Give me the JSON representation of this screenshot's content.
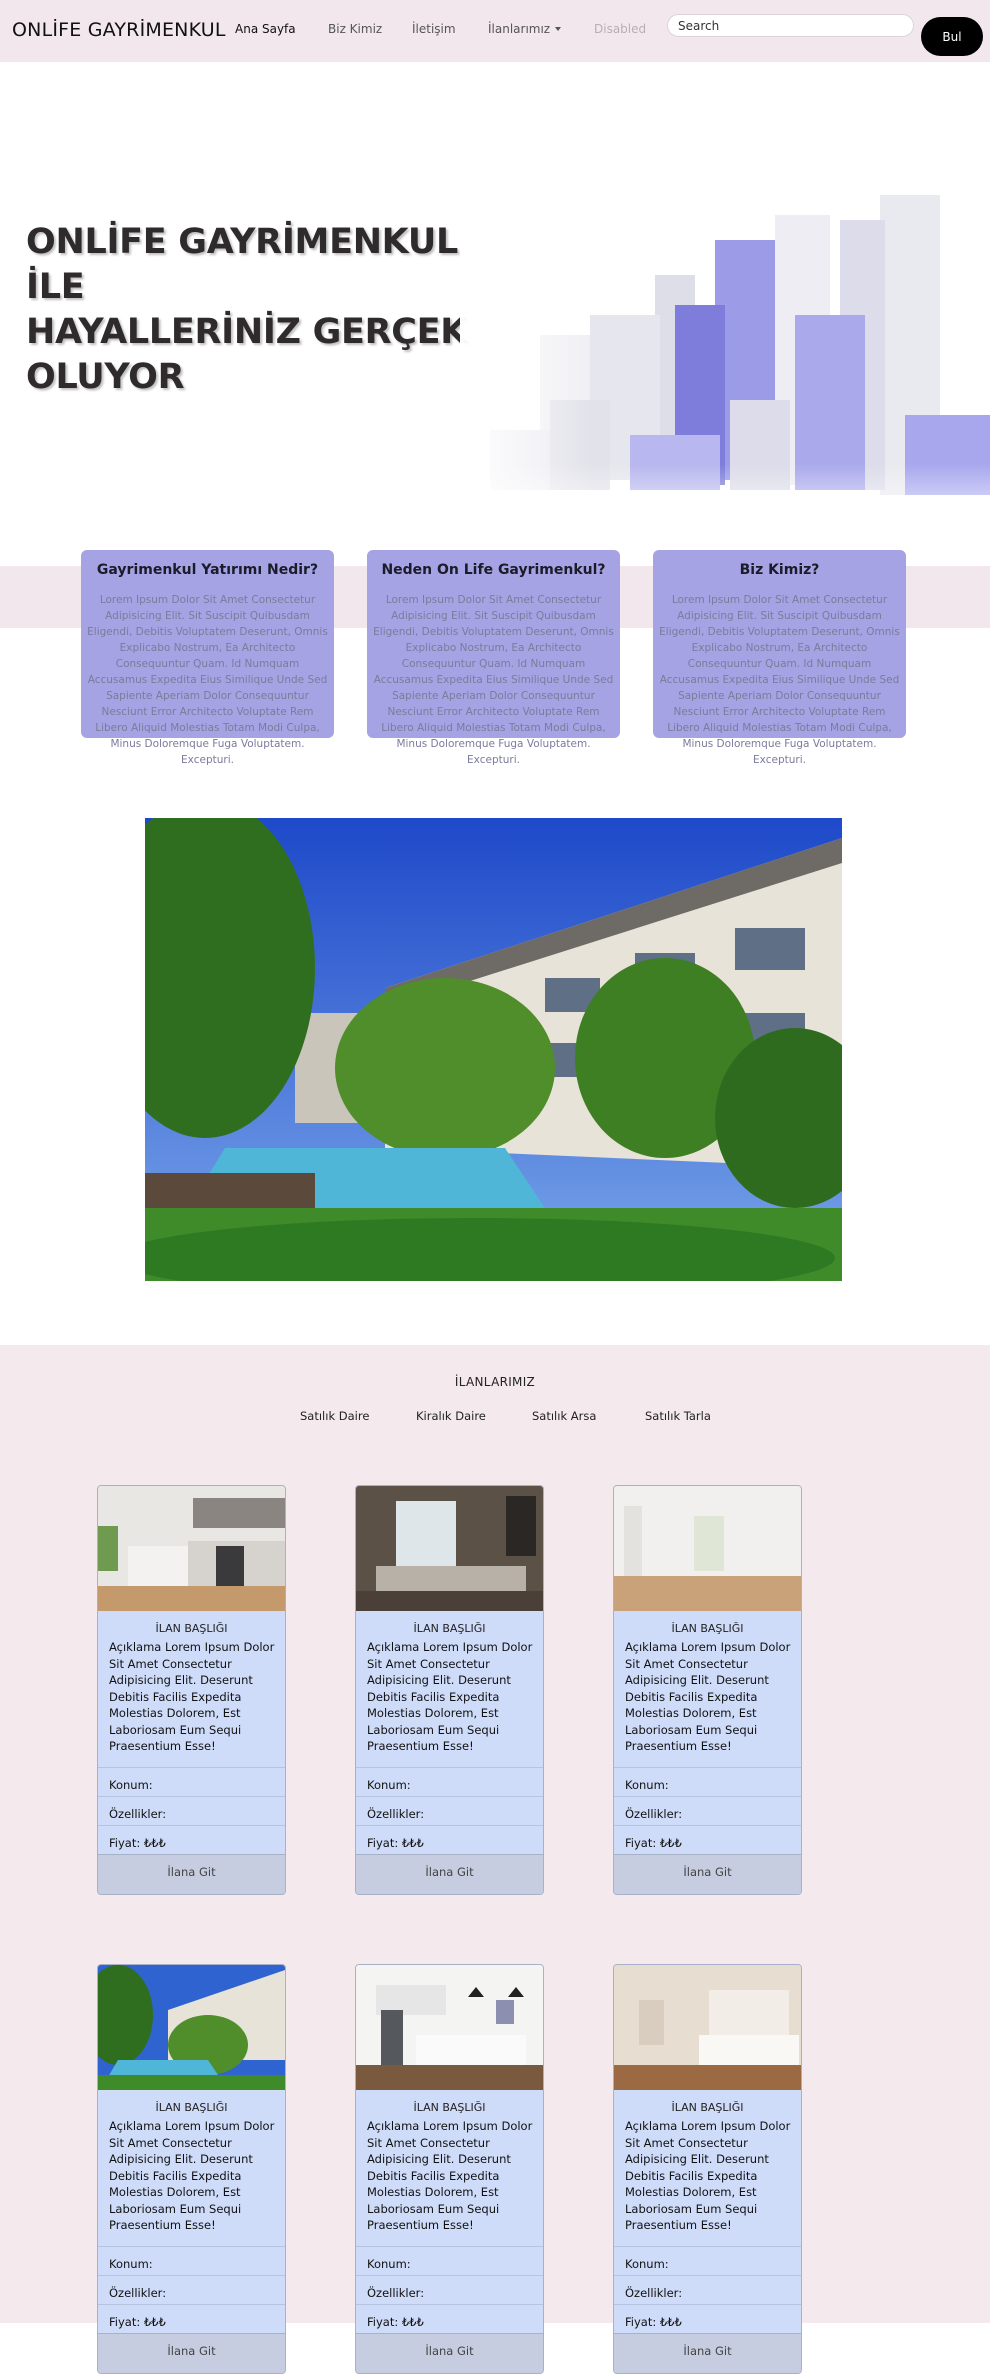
{
  "navbar": {
    "brand": "ONLİFE GAYRİMENKUL",
    "links": [
      "Ana Sayfa",
      "Biz Kimiz",
      "İletişim",
      "İlanlarımız",
      "Disabled"
    ],
    "search_placeholder": "Search",
    "search_button": "Bul"
  },
  "hero": {
    "lines": [
      "ONLİFE GAYRİMENKUL",
      "İLE",
      "HAYALLERİNİZ GERÇEK",
      "OLUYOR"
    ]
  },
  "info_cards": [
    {
      "title": "Gayrimenkul Yatırımı Nedir?",
      "text": "Lorem Ipsum Dolor Sit Amet Consectetur Adipisicing Elit. Sit Suscipit Quibusdam Eligendi, Debitis Voluptatem Deserunt, Omnis Explicabo Nostrum, Ea Architecto Consequuntur Quam. Id Numquam Accusamus Expedita Eius Similique Unde Sed Sapiente Aperiam Dolor Consequuntur Nesciunt Error Architecto Voluptate Rem Libero Aliquid Molestias Totam Modi Culpa, Minus Doloremque Fuga Voluptatem. Excepturi."
    },
    {
      "title": "Neden On Life Gayrimenkul?",
      "text": "Lorem Ipsum Dolor Sit Amet Consectetur Adipisicing Elit. Sit Suscipit Quibusdam Eligendi, Debitis Voluptatem Deserunt, Omnis Explicabo Nostrum, Ea Architecto Consequuntur Quam. Id Numquam Accusamus Expedita Eius Similique Unde Sed Sapiente Aperiam Dolor Consequuntur Nesciunt Error Architecto Voluptate Rem Libero Aliquid Molestias Totam Modi Culpa, Minus Doloremque Fuga Voluptatem. Excepturi."
    },
    {
      "title": "Biz Kimiz?",
      "text": "Lorem Ipsum Dolor Sit Amet Consectetur Adipisicing Elit. Sit Suscipit Quibusdam Eligendi, Debitis Voluptatem Deserunt, Omnis Explicabo Nostrum, Ea Architecto Consequuntur Quam. Id Numquam Accusamus Expedita Eius Similique Unde Sed Sapiente Aperiam Dolor Consequuntur Nesciunt Error Architecto Voluptate Rem Libero Aliquid Molestias Totam Modi Culpa, Minus Doloremque Fuga Voluptatem. Excepturi."
    }
  ],
  "listings": {
    "title": "İLANLARIMIZ",
    "categories": [
      "Satılık Daire",
      "Kiralık Daire",
      "Satılık Arsa",
      "Satılık Tarla"
    ],
    "cards": [
      {
        "image": "kitchen-photo",
        "heading": "İLAN BAŞLIĞI",
        "description": "Açıklama Lorem Ipsum Dolor Sit Amet Consectetur Adipisicing Elit. Deserunt Debitis Facilis Expedita Molestias Dolorem, Est Laboriosam Eum Sequi Praesentium Esse!",
        "location": "Konum:",
        "features": "Özellikler:",
        "price": "Fiyat: ₺₺₺",
        "button": "İlana Git"
      },
      {
        "image": "living-room-photo",
        "heading": "İLAN BAŞLIĞI",
        "description": "Açıklama Lorem Ipsum Dolor Sit Amet Consectetur Adipisicing Elit. Deserunt Debitis Facilis Expedita Molestias Dolorem, Est Laboriosam Eum Sequi Praesentium Esse!",
        "location": "Konum:",
        "features": "Özellikler:",
        "price": "Fiyat: ₺₺₺",
        "button": "İlana Git"
      },
      {
        "image": "empty-room-photo",
        "heading": "İLAN BAŞLIĞI",
        "description": "Açıklama Lorem Ipsum Dolor Sit Amet Consectetur Adipisicing Elit. Deserunt Debitis Facilis Expedita Molestias Dolorem, Est Laboriosam Eum Sequi Praesentium Esse!",
        "location": "Konum:",
        "features": "Özellikler:",
        "price": "Fiyat: ₺₺₺",
        "button": "İlana Git"
      },
      {
        "image": "pool-building-photo",
        "heading": "İLAN BAŞLIĞI",
        "description": "Açıklama Lorem Ipsum Dolor Sit Amet Consectetur Adipisicing Elit. Deserunt Debitis Facilis Expedita Molestias Dolorem, Est Laboriosam Eum Sequi Praesentium Esse!",
        "location": "Konum:",
        "features": "Özellikler:",
        "price": "Fiyat: ₺₺₺",
        "button": "İlana Git"
      },
      {
        "image": "modern-kitchen-photo",
        "heading": "İLAN BAŞLIĞI",
        "description": "Açıklama Lorem Ipsum Dolor Sit Amet Consectetur Adipisicing Elit. Deserunt Debitis Facilis Expedita Molestias Dolorem, Est Laboriosam Eum Sequi Praesentium Esse!",
        "location": "Konum:",
        "features": "Özellikler:",
        "price": "Fiyat: ₺₺₺",
        "button": "İlana Git"
      },
      {
        "image": "bedroom-photo",
        "heading": "İLAN BAŞLIĞI",
        "description": "Açıklama Lorem Ipsum Dolor Sit Amet Consectetur Adipisicing Elit. Deserunt Debitis Facilis Expedita Molestias Dolorem, Est Laboriosam Eum Sequi Praesentium Esse!",
        "location": "Konum:",
        "features": "Özellikler:",
        "price": "Fiyat: ₺₺₺",
        "button": "İlana Git"
      }
    ]
  },
  "colors": {
    "navbar_bg": "#f2e7ec",
    "info_card_bg": "#a5a3e3",
    "listing_card_bg": "#cfdcf9",
    "listing_section_bg": "#f4eaee"
  }
}
